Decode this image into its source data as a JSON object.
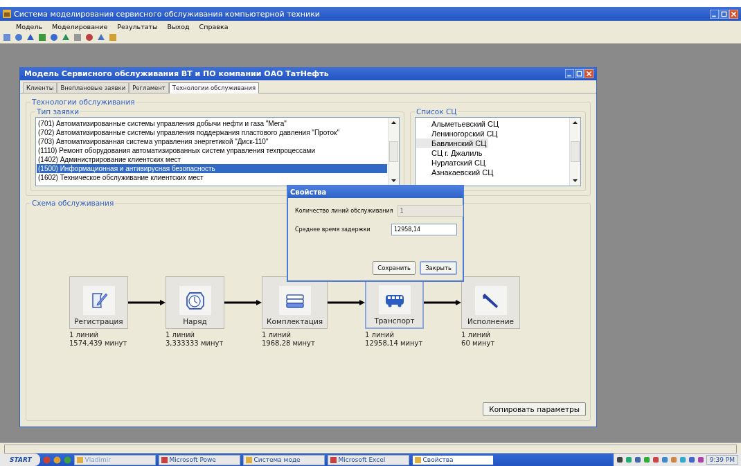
{
  "app": {
    "title": "Система моделирования сервисного обслуживания компьютерной техники",
    "menu": [
      "Модель",
      "Моделирование",
      "Результаты",
      "Выход",
      "Справка"
    ]
  },
  "window": {
    "title": "Модель Сервисного обслуживания ВТ и ПО компании ОАО ТатНефть",
    "tabs": [
      {
        "label": "Клиенты",
        "selected": false
      },
      {
        "label": "Внеплановые заявки",
        "selected": false
      },
      {
        "label": "Регламент",
        "selected": false
      },
      {
        "label": "Технологии обслуживания",
        "selected": true
      }
    ],
    "technologies": {
      "title": "Технологии обслуживания",
      "request_types": {
        "title": "Тип заявки",
        "items": [
          {
            "label": "(701) Автоматизированные системы управления добычи нефти и газа \"Мега\"",
            "selected": false
          },
          {
            "label": "(702) Автоматизированные системы управления поддержания пластового давления \"Проток\"",
            "selected": false
          },
          {
            "label": "(703) Автоматизированная система управления энергетикой \"Диск-110\"",
            "selected": false
          },
          {
            "label": "(1110) Ремонт оборудования автоматизированных систем управления техпроцессами",
            "selected": false
          },
          {
            "label": "(1402) Администрирование клиентских мест",
            "selected": false
          },
          {
            "label": "(1500) Информационная и антивирусная безопасность",
            "selected": true
          },
          {
            "label": "(1602) Техническое обслуживание клиентских мест",
            "selected": false
          }
        ]
      },
      "service_centers": {
        "title": "Список СЦ",
        "items": [
          {
            "label": "Альметьевский СЦ",
            "selected": false
          },
          {
            "label": "Лениногорский СЦ",
            "selected": false
          },
          {
            "label": "Бавлинский СЦ",
            "selected": true
          },
          {
            "label": "СЦ г. Джалиль",
            "selected": false
          },
          {
            "label": "Нурлатский СЦ",
            "selected": false
          },
          {
            "label": "Азнакаевский СЦ",
            "selected": false
          }
        ]
      }
    },
    "scheme": {
      "title": "Схема обслуживания",
      "nodes": [
        {
          "kind": "form",
          "label": "Регистрация",
          "lines": "1 линий",
          "time": "1574,439 минут",
          "selected": false
        },
        {
          "kind": "clock",
          "label": "Наряд",
          "lines": "1 линий",
          "time": "3,333333 минут",
          "selected": false
        },
        {
          "kind": "stack",
          "label": "Комплектация",
          "lines": "1 линий",
          "time": "1968,28 минут",
          "selected": false
        },
        {
          "kind": "bus",
          "label": "Транспорт",
          "lines": "1 линий",
          "time": "12958,14 минут",
          "selected": true
        },
        {
          "kind": "wrench",
          "label": "Исполнение",
          "lines": "1 линий",
          "time": "60 минут",
          "selected": false
        }
      ],
      "copy_button": "Копировать параметры"
    }
  },
  "dialog": {
    "title": "Свойства",
    "fields": [
      {
        "label": "Количество линий обслуживания",
        "value": "1",
        "disabled": true
      },
      {
        "label": "Среднее время задержки",
        "value": "12958,14",
        "disabled": false
      }
    ],
    "buttons": [
      {
        "label": "Сохранить",
        "default": false
      },
      {
        "label": "Закрыть",
        "default": true
      }
    ]
  },
  "taskbar": {
    "start": "START",
    "tasks": [
      {
        "label": "Vladimir",
        "selected": false
      },
      {
        "label": "Microsoft Powe",
        "selected": false
      },
      {
        "label": "Система моде",
        "selected": false
      },
      {
        "label": "Microsoft Excel",
        "selected": false
      },
      {
        "label": "Свойства",
        "selected": true
      }
    ],
    "clock": "9:39 PM"
  }
}
